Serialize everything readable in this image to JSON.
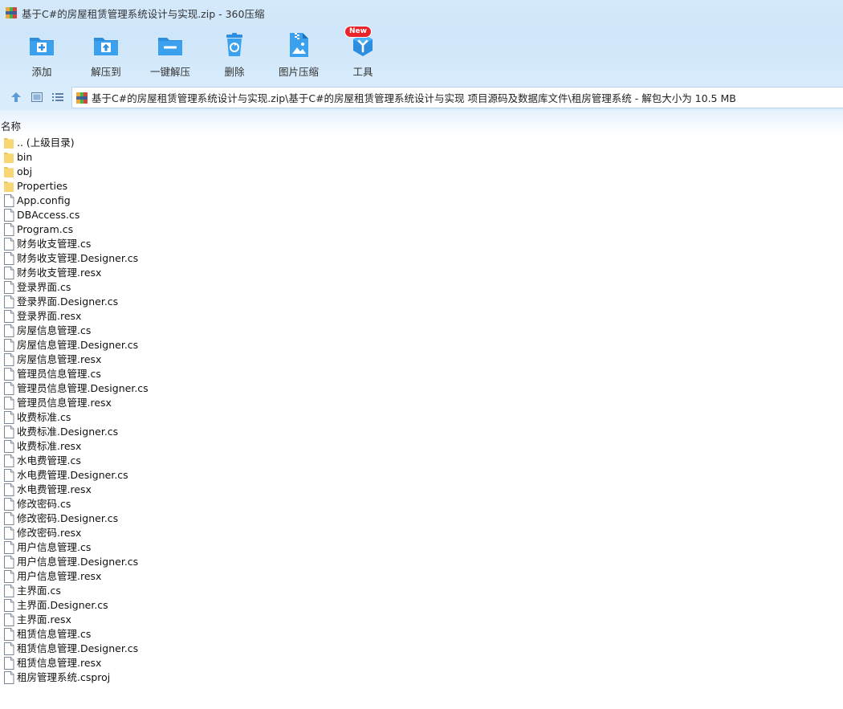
{
  "window": {
    "title": "基于C#的房屋租赁管理系统设计与实现.zip - 360压缩"
  },
  "toolbar": {
    "items": [
      {
        "label": "添加",
        "icon": "add-folder-icon"
      },
      {
        "label": "解压到",
        "icon": "extract-to-icon"
      },
      {
        "label": "一键解压",
        "icon": "one-click-extract-icon"
      },
      {
        "label": "删除",
        "icon": "recycle-bin-icon"
      },
      {
        "label": "图片压缩",
        "icon": "image-compress-icon"
      },
      {
        "label": "工具",
        "icon": "tools-icon",
        "badge": "New"
      }
    ]
  },
  "navigation": {
    "up_icon": "arrow-up-icon",
    "view_icon": "view-mode-icon",
    "list_icon": "list-view-icon",
    "address": "基于C#的房屋租赁管理系统设计与实现.zip\\基于C#的房屋租赁管理系统设计与实现 项目源码及数据库文件\\租房管理系统 - 解包大小为 10.5 MB"
  },
  "columns": {
    "name": "名称"
  },
  "files": [
    {
      "name": ".. (上级目录)",
      "type": "folder"
    },
    {
      "name": "bin",
      "type": "folder"
    },
    {
      "name": "obj",
      "type": "folder"
    },
    {
      "name": "Properties",
      "type": "folder"
    },
    {
      "name": "App.config",
      "type": "file"
    },
    {
      "name": "DBAccess.cs",
      "type": "file"
    },
    {
      "name": "Program.cs",
      "type": "file"
    },
    {
      "name": "财务收支管理.cs",
      "type": "file"
    },
    {
      "name": "财务收支管理.Designer.cs",
      "type": "file"
    },
    {
      "name": "财务收支管理.resx",
      "type": "file"
    },
    {
      "name": "登录界面.cs",
      "type": "file"
    },
    {
      "name": "登录界面.Designer.cs",
      "type": "file"
    },
    {
      "name": "登录界面.resx",
      "type": "file"
    },
    {
      "name": "房屋信息管理.cs",
      "type": "file"
    },
    {
      "name": "房屋信息管理.Designer.cs",
      "type": "file"
    },
    {
      "name": "房屋信息管理.resx",
      "type": "file"
    },
    {
      "name": "管理员信息管理.cs",
      "type": "file"
    },
    {
      "name": "管理员信息管理.Designer.cs",
      "type": "file"
    },
    {
      "name": "管理员信息管理.resx",
      "type": "file"
    },
    {
      "name": "收费标准.cs",
      "type": "file"
    },
    {
      "name": "收费标准.Designer.cs",
      "type": "file"
    },
    {
      "name": "收费标准.resx",
      "type": "file"
    },
    {
      "name": "水电费管理.cs",
      "type": "file"
    },
    {
      "name": "水电费管理.Designer.cs",
      "type": "file"
    },
    {
      "name": "水电费管理.resx",
      "type": "file"
    },
    {
      "name": "修改密码.cs",
      "type": "file"
    },
    {
      "name": "修改密码.Designer.cs",
      "type": "file"
    },
    {
      "name": "修改密码.resx",
      "type": "file"
    },
    {
      "name": "用户信息管理.cs",
      "type": "file"
    },
    {
      "name": "用户信息管理.Designer.cs",
      "type": "file"
    },
    {
      "name": "用户信息管理.resx",
      "type": "file"
    },
    {
      "name": "主界面.cs",
      "type": "file"
    },
    {
      "name": "主界面.Designer.cs",
      "type": "file"
    },
    {
      "name": "主界面.resx",
      "type": "file"
    },
    {
      "name": "租赁信息管理.cs",
      "type": "file"
    },
    {
      "name": "租赁信息管理.Designer.cs",
      "type": "file"
    },
    {
      "name": "租赁信息管理.resx",
      "type": "file"
    },
    {
      "name": "租房管理系统.csproj",
      "type": "file"
    }
  ],
  "colors": {
    "header_bg": "#cfe6fa",
    "icon_blue": "#2d8ee0",
    "folder_yellow": "#f7d774",
    "badge_red": "#e8262a"
  }
}
